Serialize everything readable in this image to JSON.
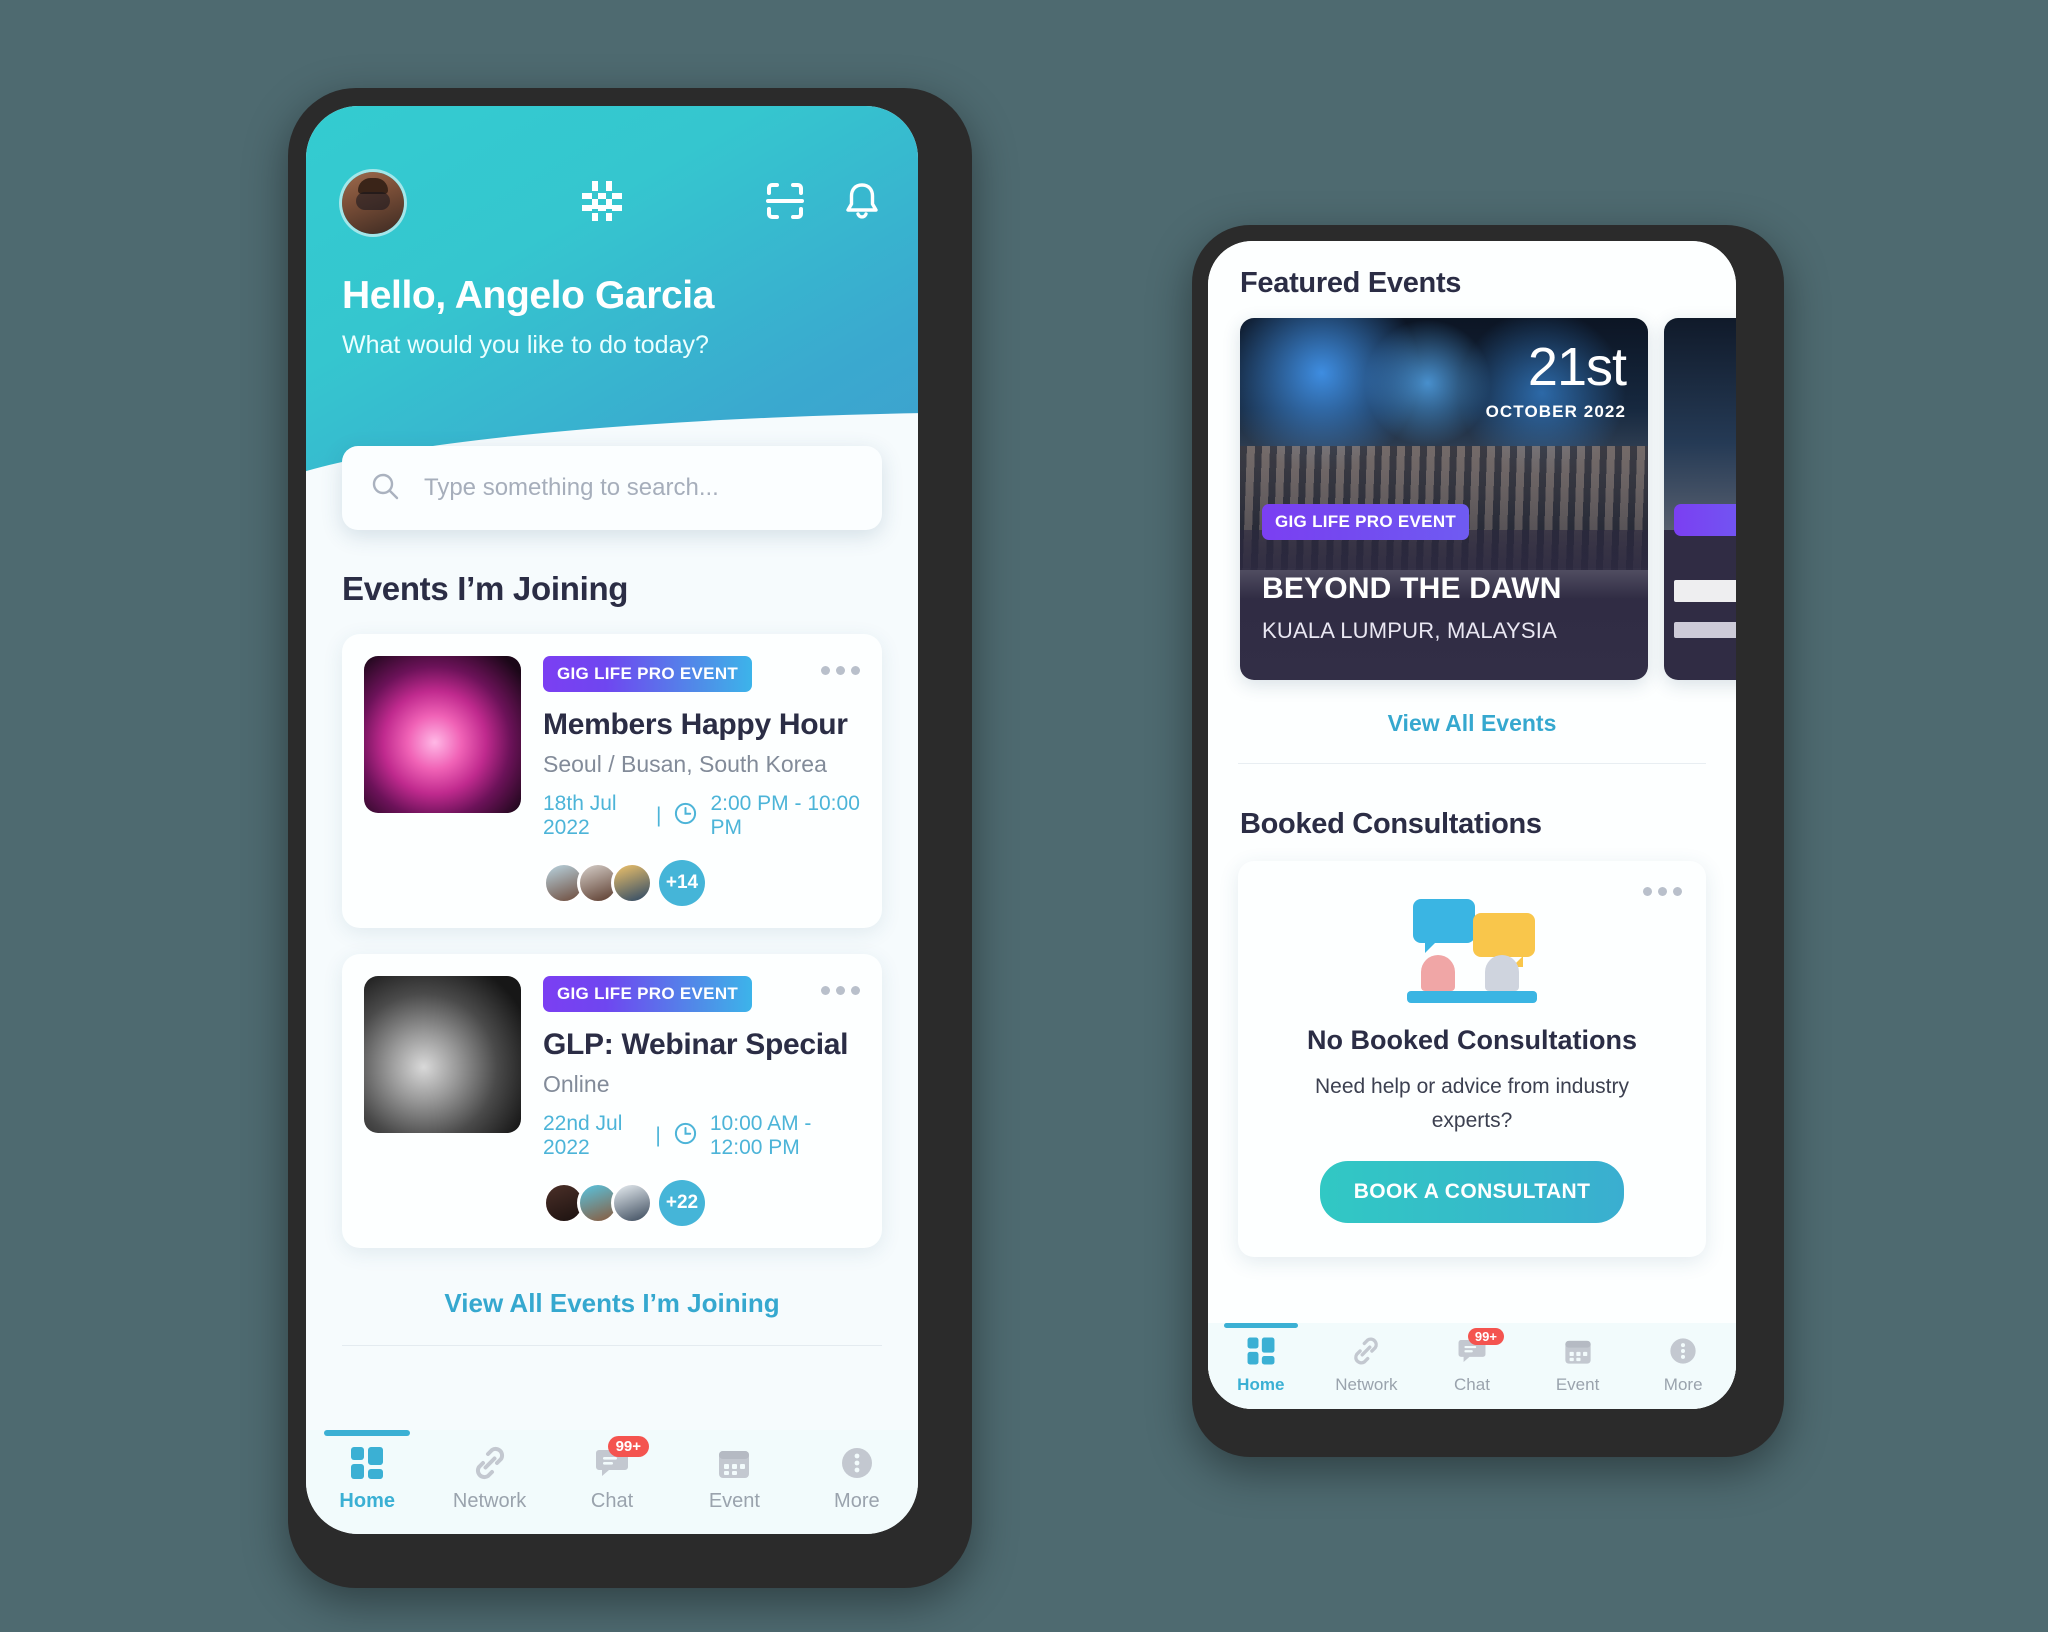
{
  "colors": {
    "brand_teal": "#3bb0d4",
    "hero_gradient_start": "#33ccd0",
    "hero_gradient_end": "#3f9fce",
    "tag_purple": "#7b3ff2",
    "badge_red": "#f4544f",
    "dark_navy": "#2b2d45"
  },
  "left_phone": {
    "header": {
      "avatar_name": "user-avatar",
      "logo_name": "gig-life-hash-logo",
      "scan_icon": "qr-scan-icon",
      "bell_icon": "notification-bell-icon",
      "greeting": "Hello, Angelo Garcia",
      "subtitle": "What would you like to do today?"
    },
    "search": {
      "placeholder": "Type something to search...",
      "value": "",
      "icon": "search-icon"
    },
    "events_section": {
      "title": "Events I’m Joining",
      "view_all_label": "View All Events I’m Joining",
      "cards": [
        {
          "tag": "GIG LIFE PRO EVENT",
          "name": "Members Happy Hour",
          "location": "Seoul / Busan, South Korea",
          "date": "18th Jul 2022",
          "separator": "|",
          "time": "2:00 PM - 10:00 PM",
          "attendees_more": "+14",
          "thumb_class": "thumb-concert"
        },
        {
          "tag": "GIG LIFE PRO EVENT",
          "name": "GLP: Webinar Special",
          "location": "Online",
          "date": "22nd Jul 2022",
          "separator": "|",
          "time": "10:00 AM - 12:00 PM",
          "attendees_more": "+22",
          "thumb_class": "thumb-guitar"
        }
      ]
    },
    "bottom_nav": [
      {
        "label": "Home",
        "icon": "grid-icon",
        "active": true,
        "badge": ""
      },
      {
        "label": "Network",
        "icon": "link-icon",
        "active": false,
        "badge": ""
      },
      {
        "label": "Chat",
        "icon": "chat-bubble-icon",
        "active": false,
        "badge": "99+"
      },
      {
        "label": "Event",
        "icon": "calendar-icon",
        "active": false,
        "badge": ""
      },
      {
        "label": "More",
        "icon": "more-dots-icon",
        "active": false,
        "badge": ""
      }
    ]
  },
  "right_phone": {
    "featured": {
      "title": "Featured Events",
      "view_all_label": "View All Events",
      "card": {
        "day": "21st",
        "month_year": "OCTOBER 2022",
        "tag": "GIG LIFE PRO EVENT",
        "name": "BEYOND THE DAWN",
        "location": "KUALA LUMPUR, MALAYSIA"
      }
    },
    "consultations": {
      "title": "Booked Consultations",
      "empty_title": "No Booked Consultations",
      "empty_desc": "Need help or advice from industry experts?",
      "button_label": "BOOK A CONSULTANT",
      "illustration": "chat-consultation-illustration"
    },
    "bottom_nav": [
      {
        "label": "Home",
        "icon": "grid-icon",
        "active": true,
        "badge": ""
      },
      {
        "label": "Network",
        "icon": "link-icon",
        "active": false,
        "badge": ""
      },
      {
        "label": "Chat",
        "icon": "chat-bubble-icon",
        "active": false,
        "badge": "99+"
      },
      {
        "label": "Event",
        "icon": "calendar-icon",
        "active": false,
        "badge": ""
      },
      {
        "label": "More",
        "icon": "more-dots-icon",
        "active": false,
        "badge": ""
      }
    ]
  }
}
